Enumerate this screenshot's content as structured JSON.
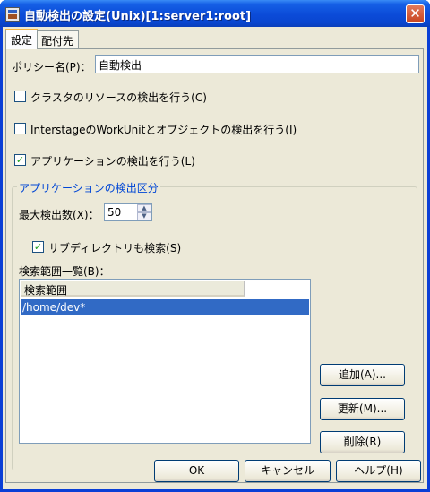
{
  "window": {
    "title": "自動検出の設定(Unix)[1:server1:root]",
    "close_glyph": "✕"
  },
  "tabs": [
    {
      "label": "設定"
    },
    {
      "label": "配付先"
    }
  ],
  "policy": {
    "label": "ポリシー名(P)：",
    "value": "自動検出"
  },
  "checks": {
    "cluster": {
      "label": "クラスタのリソースの検出を行う(C)",
      "checked": false
    },
    "interstage": {
      "label": "InterstageのWorkUnitとオブジェクトの検出を行う(I)",
      "checked": false
    },
    "application": {
      "label": "アプリケーションの検出を行う(L)",
      "checked": true
    }
  },
  "app_group": {
    "title": "アプリケーションの検出区分",
    "max_label": "最大検出数(X)：",
    "max_value": "50",
    "subdir_label": "サブディレクトリも検索(S)",
    "subdir_checked": true,
    "range_list_label": "検索範囲一覧(B)：",
    "column_header": "検索範囲",
    "rows": [
      "/home/dev*"
    ]
  },
  "side_buttons": {
    "add": "追加(A)...",
    "update": "更新(M)...",
    "delete": "削除(R)"
  },
  "footer": {
    "ok": "OK",
    "cancel": "キャンセル",
    "help": "ヘルプ(H)"
  },
  "check_glyph": "✓"
}
